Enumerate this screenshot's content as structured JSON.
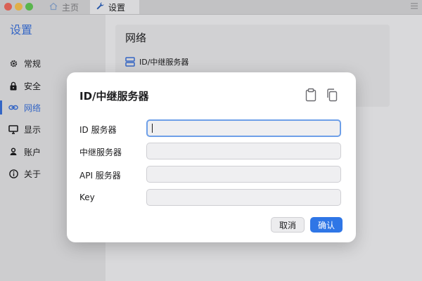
{
  "titlebar": {
    "tabs": [
      {
        "label": "主页",
        "icon": "home-icon"
      },
      {
        "label": "设置",
        "icon": "wrench-icon"
      }
    ],
    "menu_icon": "menu-icon"
  },
  "sidebar": {
    "title": "设置",
    "items": [
      {
        "label": "常规",
        "icon": "gear-icon"
      },
      {
        "label": "安全",
        "icon": "lock-icon"
      },
      {
        "label": "网络",
        "icon": "link-icon",
        "active": true
      },
      {
        "label": "显示",
        "icon": "monitor-icon"
      },
      {
        "label": "账户",
        "icon": "user-icon"
      },
      {
        "label": "关于",
        "icon": "info-icon"
      }
    ]
  },
  "main": {
    "section_title": "网络",
    "row_label": "ID/中继服务器"
  },
  "dialog": {
    "title": "ID/中继服务器",
    "fields": [
      {
        "label": "ID 服务器",
        "value": ""
      },
      {
        "label": "中继服务器",
        "value": ""
      },
      {
        "label": "API 服务器",
        "value": ""
      },
      {
        "label": "Key",
        "value": ""
      }
    ],
    "cancel_label": "取消",
    "ok_label": "确认"
  },
  "colors": {
    "accent": "#3a6fd6",
    "button_primary": "#2f76e6"
  }
}
